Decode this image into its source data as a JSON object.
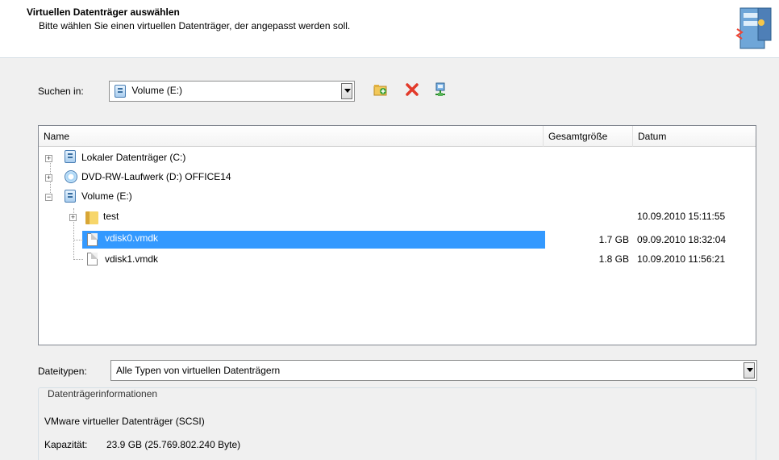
{
  "header": {
    "title": "Virtuellen Datenträger auswählen",
    "subtitle": "Bitte wählen Sie einen virtuellen Datenträger, der angepasst werden soll."
  },
  "search": {
    "label": "Suchen in:",
    "value": "Volume (E:)"
  },
  "toolbar": {
    "icons": [
      "new-folder-icon",
      "delete-icon",
      "network-drive-icon"
    ]
  },
  "list": {
    "columns": [
      "Name",
      "Gesamtgröße",
      "Datum"
    ],
    "rows": [
      {
        "name": "Lokaler Datenträger (C:)",
        "size": "",
        "date": "",
        "icon": "drive-icon"
      },
      {
        "name": "DVD-RW-Laufwerk (D:) OFFICE14",
        "size": "",
        "date": "",
        "icon": "dvd-icon"
      },
      {
        "name": "Volume (E:)",
        "size": "",
        "date": "",
        "icon": "drive-icon"
      },
      {
        "name": "test",
        "size": "",
        "date": "10.09.2010 15:11:55",
        "icon": "folder-icon"
      },
      {
        "name": "vdisk0.vmdk",
        "size": "1.7 GB",
        "date": "09.09.2010 18:32:04",
        "icon": "file-icon",
        "selected": true
      },
      {
        "name": "vdisk1.vmdk",
        "size": "1.8 GB",
        "date": "10.09.2010 11:56:21",
        "icon": "file-icon"
      }
    ]
  },
  "filetypes": {
    "label": "Dateitypen:",
    "value": "Alle Typen von virtuellen Datenträgern"
  },
  "info": {
    "group_title": "Datenträgerinformationen",
    "type": "VMware virtueller Datenträger (SCSI)",
    "capacity_label": "Kapazität:",
    "capacity_value": "23.9 GB (25.769.802.240 Byte)"
  },
  "colors": {
    "selection": "#3399ff",
    "background": "#f0f0f0"
  }
}
